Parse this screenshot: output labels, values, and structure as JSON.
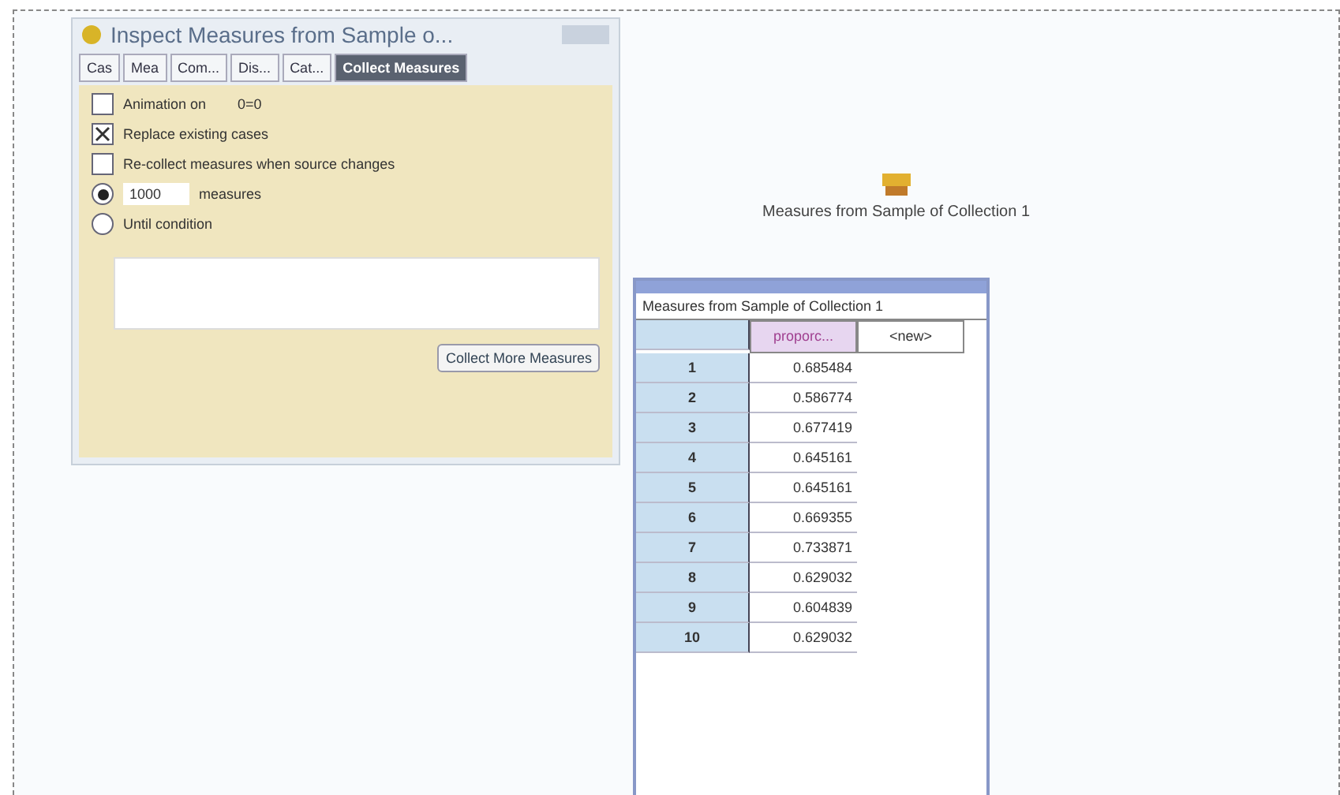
{
  "inspector": {
    "title": "Inspect Measures from Sample o...",
    "tabs": [
      {
        "label": "Cas",
        "selected": false
      },
      {
        "label": "Mea",
        "selected": false
      },
      {
        "label": "Com...",
        "selected": false
      },
      {
        "label": "Dis...",
        "selected": false
      },
      {
        "label": "Cat...",
        "selected": false
      },
      {
        "label": "Collect Measures",
        "selected": true
      }
    ],
    "options": [
      {
        "kind": "checkbox",
        "label": "Animation on",
        "checked": false,
        "note": "0=0"
      },
      {
        "kind": "checkbox",
        "label": "Replace existing cases",
        "checked": true
      },
      {
        "kind": "checkbox",
        "label": "Re-collect measures when source changes",
        "checked": false
      },
      {
        "kind": "radio",
        "value": "1000",
        "label": "measures",
        "selected": true
      },
      {
        "kind": "radio",
        "label": "Until condition",
        "selected": false
      }
    ],
    "button": "Collect More Measures"
  },
  "collection": {
    "label": "Measures from Sample of Collection 1"
  },
  "table": {
    "title": "Measures from Sample of Collection 1",
    "columns": [
      "",
      "proporc...",
      "<new>"
    ],
    "rows": [
      [
        "1",
        "0.685484"
      ],
      [
        "2",
        "0.586774"
      ],
      [
        "3",
        "0.677419"
      ],
      [
        "4",
        "0.645161"
      ],
      [
        "5",
        "0.645161"
      ],
      [
        "6",
        "0.669355"
      ],
      [
        "7",
        "0.733871"
      ],
      [
        "8",
        "0.629032"
      ],
      [
        "9",
        "0.604839"
      ],
      [
        "10",
        "0.629032"
      ]
    ]
  }
}
